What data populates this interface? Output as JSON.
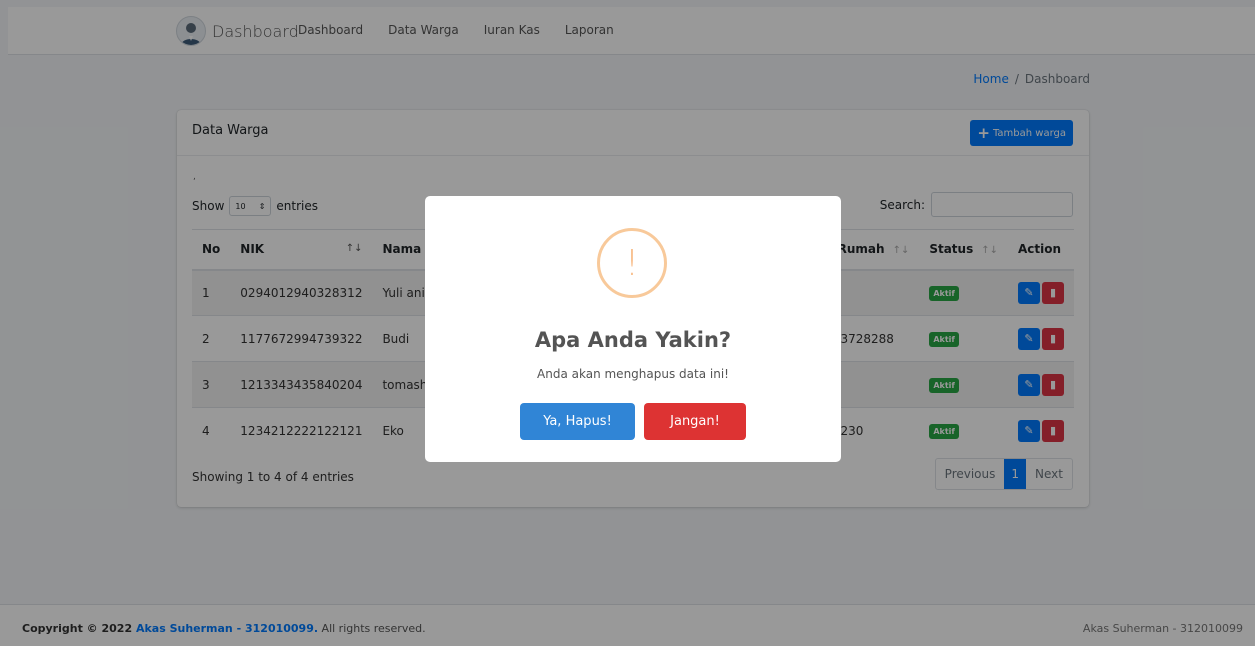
{
  "navbar": {
    "brand": "Dashboard",
    "links": [
      "Dashboard",
      "Data Warga",
      "Iuran Kas",
      "Laporan"
    ]
  },
  "breadcrumb": {
    "home": "Home",
    "separator": "/",
    "current": "Dashboard"
  },
  "card": {
    "title": "Data Warga",
    "add_button": "Tambah warga",
    "dot": ",",
    "show_label": "Show",
    "entries_value": "10",
    "entries_label": "entries",
    "search_label": "Search:",
    "columns": [
      "No",
      "NIK",
      "Nama Wa",
      "o Rumah",
      "Status",
      "Action"
    ],
    "rows": [
      {
        "no": "1",
        "nik": "0294012940328312",
        "nama": "Yuli ani",
        "rumah": ")",
        "status": "Aktif"
      },
      {
        "no": "2",
        "nik": "1177672994739322",
        "nama": "Budi",
        "rumah": "393728288",
        "status": "Aktif"
      },
      {
        "no": "3",
        "nik": "1213343435840204",
        "nama": "tomash",
        "rumah": "",
        "status": "Aktif"
      },
      {
        "no": "4",
        "nik": "1234212222122121",
        "nama": "Eko",
        "rumah": "30230",
        "status": "Aktif"
      }
    ],
    "showing": "Showing 1 to 4 of 4 entries",
    "pager": {
      "previous": "Previous",
      "page": "1",
      "next": "Next"
    }
  },
  "footer": {
    "copyright": "Copyright © 2022 ",
    "author": "Akas Suherman - 312010099.",
    "rights": " All rights reserved.",
    "right": "Akas Suherman - 312010099"
  },
  "modal": {
    "icon": "!",
    "title": "Apa Anda Yakin?",
    "text": "Anda akan menghapus data ini!",
    "confirm": "Ya, Hapus!",
    "cancel": "Jangan!"
  },
  "colors": {
    "primary": "#007bff",
    "danger": "#dc3545",
    "success": "#28a745",
    "confirm": "#3085d6",
    "cancel": "#dd3333",
    "warning_icon": "#f8bb86"
  }
}
